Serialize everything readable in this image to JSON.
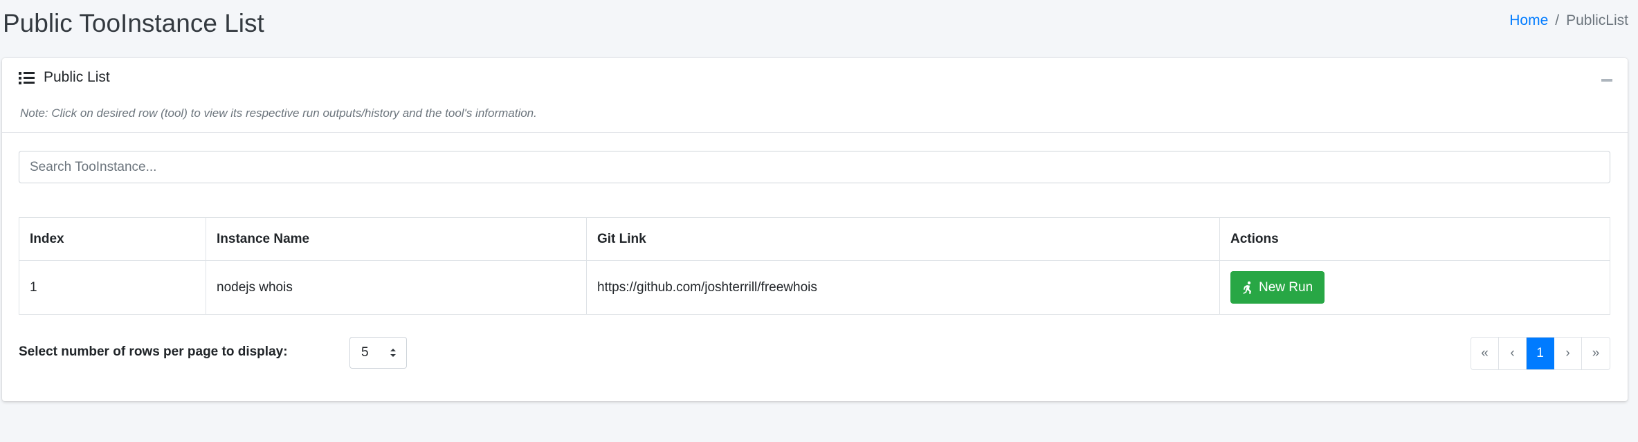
{
  "page": {
    "title": "Public TooInstance List"
  },
  "breadcrumb": {
    "home": "Home",
    "separator": "/",
    "current": "PublicList"
  },
  "card": {
    "title": "Public List",
    "icon": "list-icon",
    "note": "Note: Click on desired row (tool) to view its respective run outputs/history and the tool's information."
  },
  "search": {
    "placeholder": "Search TooInstance...",
    "value": ""
  },
  "table": {
    "headers": [
      "Index",
      "Instance Name",
      "Git Link",
      "Actions"
    ],
    "rows": [
      {
        "index": "1",
        "instance_name": "nodejs whois",
        "git_link": "https://github.com/joshterrill/freewhois",
        "action_label": "New Run"
      }
    ]
  },
  "rows_per_page": {
    "label": "Select number of rows per page to display:",
    "selected": "5"
  },
  "pagination": {
    "first": "«",
    "prev": "‹",
    "current": "1",
    "next": "›",
    "last": "»"
  },
  "colors": {
    "primary": "#007bff",
    "success": "#28a745",
    "background": "#f4f6f9"
  }
}
